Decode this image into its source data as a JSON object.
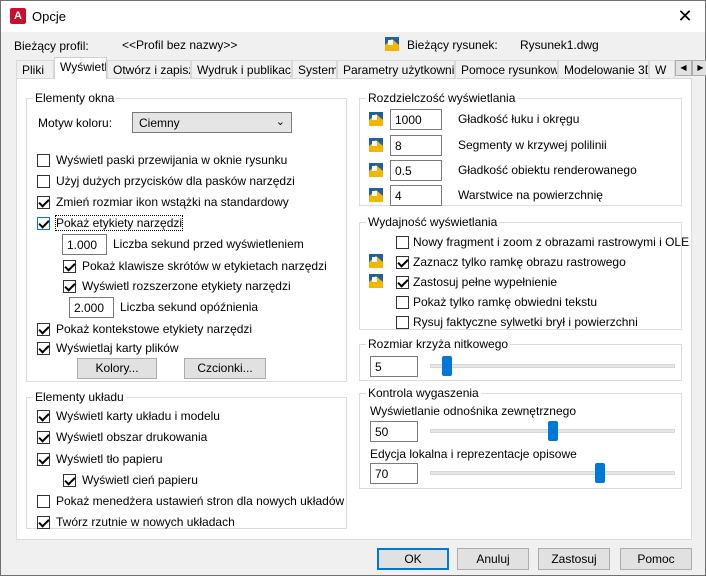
{
  "window": {
    "title": "Opcje",
    "app_icon_letter": "A"
  },
  "header": {
    "profile_label": "Bieżący profil:",
    "profile_value": "<<Profil bez nazwy>>",
    "drawing_label": "Bieżący rysunek:",
    "drawing_value": "Rysunek1.dwg"
  },
  "tabs": [
    {
      "label": "Pliki"
    },
    {
      "label": "Wyświetl"
    },
    {
      "label": "Otwórz i zapisz"
    },
    {
      "label": "Wydruk i publikacja"
    },
    {
      "label": "System"
    },
    {
      "label": "Parametry użytkownika"
    },
    {
      "label": "Pomoce rysunkowe"
    },
    {
      "label": "Modelowanie 3D"
    },
    {
      "label": "W"
    }
  ],
  "elementy_okna": {
    "title": "Elementy okna",
    "color_theme_label": "Motyw koloru:",
    "color_theme_value": "Ciemny",
    "scrollbars": "Wyświetl paski przewijania w oknie rysunku",
    "large_buttons": "Użyj dużych przycisków dla pasków narzędzi",
    "resize_ribbon": "Zmień rozmiar ikon wstążki na standardowy",
    "tooltips": "Pokaż etykiety narzędzi",
    "tooltip_delay_value": "1.000",
    "tooltip_delay_label": "Liczba sekund przed wyświetleniem",
    "shortcut_keys": "Pokaż klawisze skrótów w etykietach narzędzi",
    "extended_tooltips": "Wyświetl rozszerzone etykiety narzędzi",
    "ext_delay_value": "2.000",
    "ext_delay_label": "Liczba sekund opóźnienia",
    "rollover": "Pokaż kontekstowe etykiety narzędzi",
    "file_tabs": "Wyświetlaj karty plików",
    "colors_button": "Kolory...",
    "fonts_button": "Czcionki..."
  },
  "elementy_ukladu": {
    "title": "Elementy układu",
    "layout_tabs": "Wyświetl karty układu i modelu",
    "printable_area": "Wyświetl obszar drukowania",
    "paper_bg": "Wyświetl tło papieru",
    "paper_shadow": "Wyświetl cień papieru",
    "page_setup": "Pokaż menedżera ustawień stron dla nowych układów",
    "viewports": "Twórz rzutnie w nowych układach"
  },
  "rozdzielczosc": {
    "title": "Rozdzielczość wyświetlania",
    "arc_value": "1000",
    "arc_label": "Gładkość łuku i okręgu",
    "polyline_value": "8",
    "polyline_label": "Segmenty w krzywej polilinii",
    "render_value": "0.5",
    "render_label": "Gładkość obiektu renderowanego",
    "contour_value": "4",
    "contour_label": "Warstwice na powierzchnię"
  },
  "wydajnosc": {
    "title": "Wydajność wyświetlania",
    "pan_zoom": "Nowy fragment i zoom z obrazami rastrowymi i OLE",
    "raster_frame": "Zaznacz tylko ramkę obrazu rastrowego",
    "true_color": "Zastosuj pełne wypełnienie",
    "text_frame": "Pokaż tylko ramkę obwiedni tekstu",
    "silhouettes": "Rysuj faktyczne sylwetki brył i powierzchni"
  },
  "crosshair": {
    "title": "Rozmiar krzyża nitkowego",
    "value": "5",
    "level_percent": 5
  },
  "fade": {
    "title": "Kontrola wygaszenia",
    "xref_label": "Wyświetlanie odnośnika zewnętrznego",
    "xref_value": "50",
    "xref_percent": 50,
    "inplace_label": "Edycja lokalna i reprezentacje opisowe",
    "inplace_value": "70",
    "inplace_percent": 70
  },
  "buttons": {
    "ok": "OK",
    "cancel": "Anuluj",
    "apply": "Zastosuj",
    "help": "Pomoc"
  },
  "icons": {
    "app": "autocad-app-icon",
    "drawing": "drawing-file-icon",
    "setting": "drawing-setting-icon",
    "close": "close-icon"
  },
  "colors": {
    "accent": "#0078d7",
    "app_red": "#c8102e",
    "icon_blue": "#1f5fa6",
    "icon_yellow": "#f2b705"
  }
}
